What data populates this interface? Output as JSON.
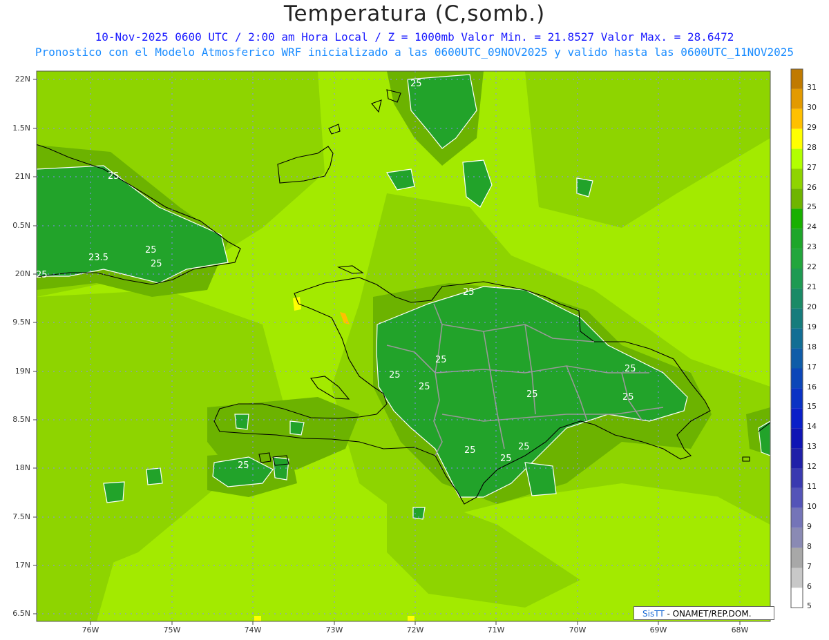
{
  "title": "Temperatura (C,somb.)",
  "subtitle_line1": "10-Nov-2025  0600 UTC / 2:00 am Hora Local / Z = 1000mb   Valor Min. = 21.8527  Valor Max. = 28.6472",
  "subtitle_line2": "Pronostico con el Modelo Atmosferico WRF inicializado a las 0600UTC_09NOV2025 y valido hasta las  0600UTC_11NOV2025",
  "lat_labels": [
    "22N",
    "1.5N",
    "21N",
    "0.5N",
    "20N",
    "9.5N",
    "19N",
    "8.5N",
    "18N",
    "7.5N",
    "17N",
    "6.5N"
  ],
  "lon_labels": [
    "76W",
    "75W",
    "74W",
    "73W",
    "72W",
    "71W",
    "70W",
    "69W",
    "68W"
  ],
  "colorbar": {
    "labels": [
      "31",
      "30",
      "29",
      "28",
      "27",
      "26",
      "25",
      "24",
      "23",
      "22",
      "21",
      "20",
      "19",
      "18",
      "17",
      "16",
      "15",
      "14",
      "13",
      "12",
      "11",
      "10",
      "9",
      "8",
      "7",
      "6",
      "5"
    ],
    "colors": [
      "#c07a00",
      "#e39a00",
      "#ffc000",
      "#ffff00",
      "#b2ff00",
      "#8fd400",
      "#6fb500",
      "#18b000",
      "#1ea62a",
      "#22a63c",
      "#1e9a52",
      "#1a8a66",
      "#167c7c",
      "#126e94",
      "#0f5ca8",
      "#0c46b8",
      "#0a32c4",
      "#0a1fc8",
      "#0f14b4",
      "#2020a8",
      "#3a3ab0",
      "#5454b8",
      "#7474b8",
      "#8a8ab4",
      "#a8a8a8",
      "#c8c8c8",
      "#ffffff"
    ]
  },
  "contour_labels": [
    "25",
    "25",
    "23.5",
    "25",
    "25",
    "25",
    "25",
    "25",
    "25",
    "25",
    "25",
    "25",
    "25",
    "25",
    "25",
    "25",
    "25"
  ],
  "credit": {
    "logo": "SisTT",
    "text": " - ONAMET/REP.DOM."
  },
  "map_colors": {
    "background": "#a3ea00",
    "mid": "#8ed400",
    "dark": "#6cb300",
    "land": "#22a32a",
    "coast": "#000000",
    "contour": "#ffffff",
    "border": "#999999",
    "grid": "#8a8aff"
  }
}
